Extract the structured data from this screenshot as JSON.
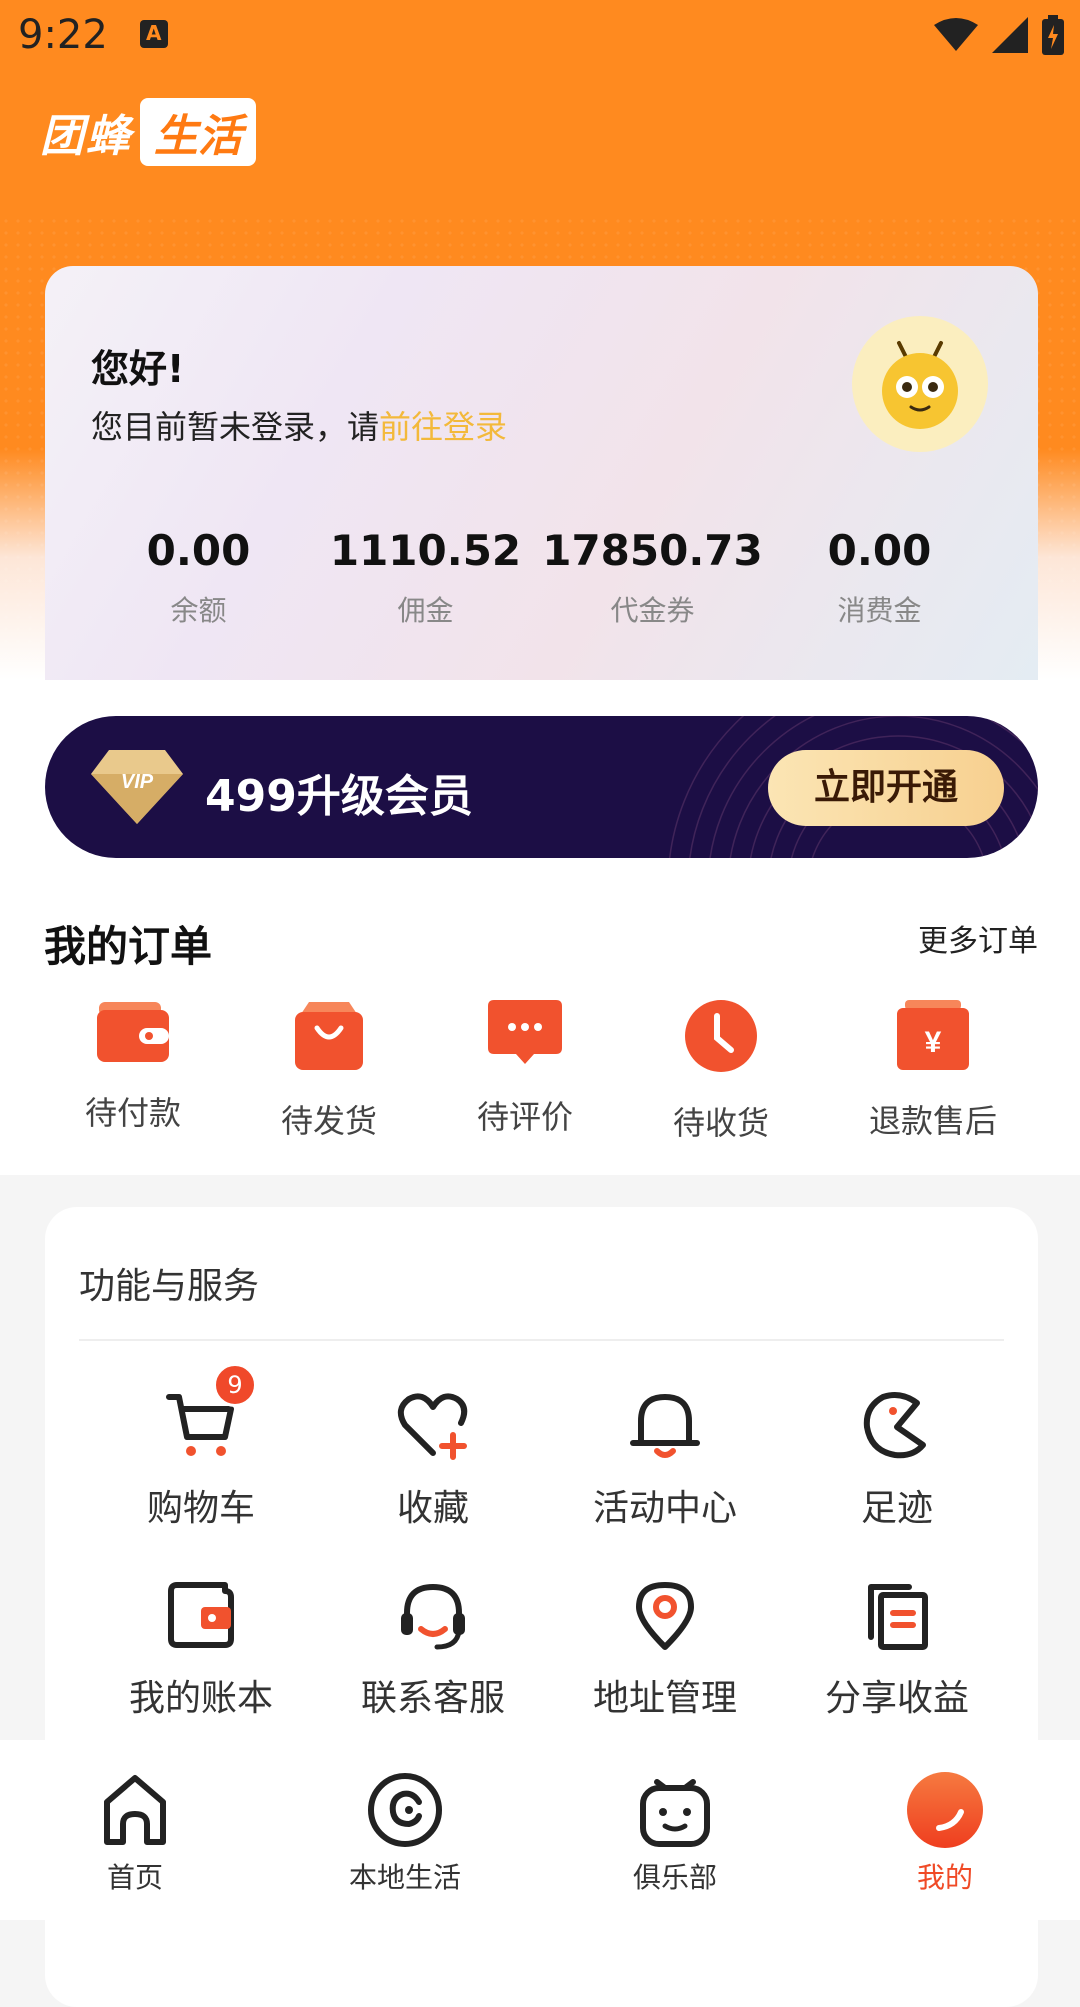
{
  "status_bar": {
    "time": "9:22"
  },
  "logo": {
    "part1": "团蜂",
    "part2": "生活"
  },
  "user": {
    "greeting": "您好!",
    "login_hint": "您目前暂未登录，请",
    "login_link": "前往登录",
    "stats": [
      {
        "value": "0.00",
        "label": "余额"
      },
      {
        "value": "1110.52",
        "label": "佣金"
      },
      {
        "value": "17850.73",
        "label": "代金券"
      },
      {
        "value": "0.00",
        "label": "消费金"
      }
    ]
  },
  "vip": {
    "badge": "VIP",
    "text": "499升级会员",
    "button": "立即开通"
  },
  "orders": {
    "title": "我的订单",
    "more": "更多订单",
    "items": [
      {
        "label": "待付款",
        "icon": "wallet-icon"
      },
      {
        "label": "待发货",
        "icon": "bag-icon"
      },
      {
        "label": "待评价",
        "icon": "comment-icon"
      },
      {
        "label": "待收货",
        "icon": "clock-icon"
      },
      {
        "label": "退款售后",
        "icon": "refund-icon"
      }
    ]
  },
  "services": {
    "title": "功能与服务",
    "items": [
      {
        "label": "购物车",
        "icon": "cart-icon",
        "badge": "9"
      },
      {
        "label": "收藏",
        "icon": "heart-plus-icon"
      },
      {
        "label": "活动中心",
        "icon": "bell-icon"
      },
      {
        "label": "足迹",
        "icon": "footprint-icon"
      },
      {
        "label": "我的账本",
        "icon": "ledger-icon"
      },
      {
        "label": "联系客服",
        "icon": "headset-icon"
      },
      {
        "label": "地址管理",
        "icon": "location-pin-icon"
      },
      {
        "label": "分享收益",
        "icon": "document-stack-icon"
      }
    ]
  },
  "bottom_nav": {
    "items": [
      {
        "label": "首页",
        "icon": "home-icon"
      },
      {
        "label": "本地生活",
        "icon": "local-life-icon"
      },
      {
        "label": "俱乐部",
        "icon": "club-icon"
      },
      {
        "label": "我的",
        "icon": "profile-icon",
        "active": true
      }
    ]
  },
  "colors": {
    "brand": "#ff8a1f",
    "accent": "#f04a26",
    "vip_bg": "#1c0e45"
  }
}
